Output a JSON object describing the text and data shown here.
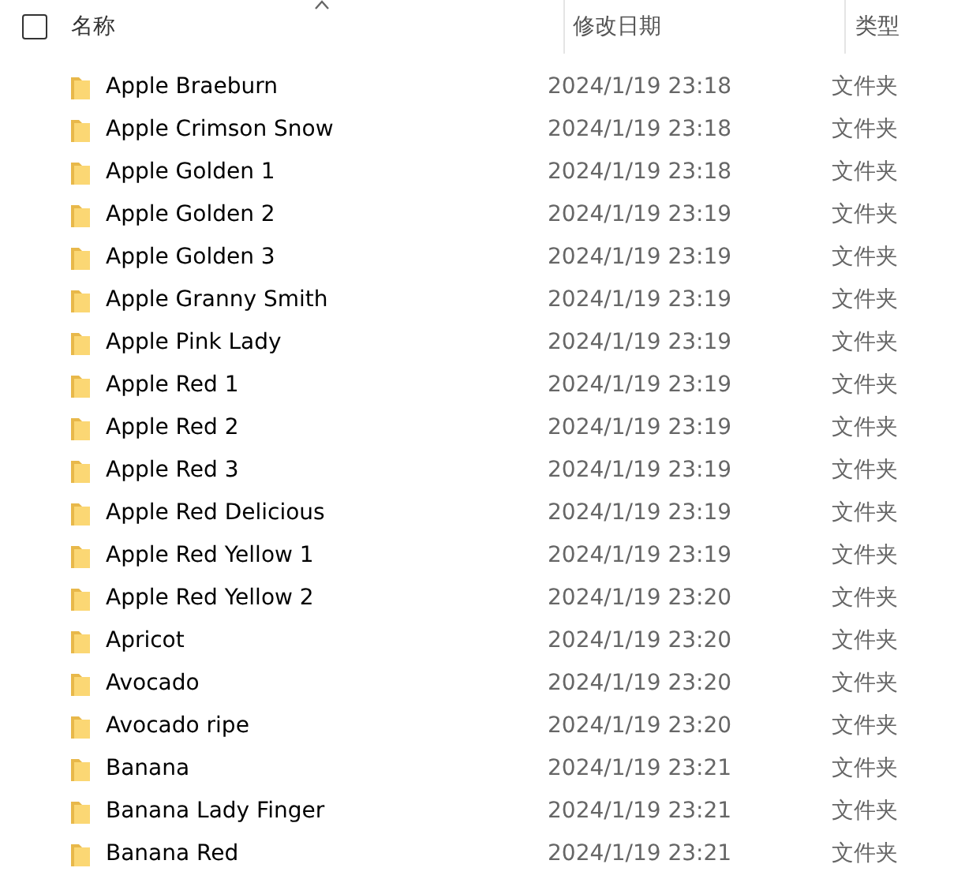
{
  "header": {
    "select_all_checked": false,
    "columns": [
      {
        "label": "名称",
        "sorted": true
      },
      {
        "label": "修改日期",
        "sorted": false
      },
      {
        "label": "类型",
        "sorted": false
      }
    ]
  },
  "rows": [
    {
      "name": "Apple Braeburn",
      "modified": "2024/1/19 23:18",
      "type": "文件夹"
    },
    {
      "name": "Apple Crimson Snow",
      "modified": "2024/1/19 23:18",
      "type": "文件夹"
    },
    {
      "name": "Apple Golden 1",
      "modified": "2024/1/19 23:18",
      "type": "文件夹"
    },
    {
      "name": "Apple Golden 2",
      "modified": "2024/1/19 23:19",
      "type": "文件夹"
    },
    {
      "name": "Apple Golden 3",
      "modified": "2024/1/19 23:19",
      "type": "文件夹"
    },
    {
      "name": "Apple Granny Smith",
      "modified": "2024/1/19 23:19",
      "type": "文件夹"
    },
    {
      "name": "Apple Pink Lady",
      "modified": "2024/1/19 23:19",
      "type": "文件夹"
    },
    {
      "name": "Apple Red 1",
      "modified": "2024/1/19 23:19",
      "type": "文件夹"
    },
    {
      "name": "Apple Red 2",
      "modified": "2024/1/19 23:19",
      "type": "文件夹"
    },
    {
      "name": "Apple Red 3",
      "modified": "2024/1/19 23:19",
      "type": "文件夹"
    },
    {
      "name": "Apple Red Delicious",
      "modified": "2024/1/19 23:19",
      "type": "文件夹"
    },
    {
      "name": "Apple Red Yellow 1",
      "modified": "2024/1/19 23:19",
      "type": "文件夹"
    },
    {
      "name": "Apple Red Yellow 2",
      "modified": "2024/1/19 23:20",
      "type": "文件夹"
    },
    {
      "name": "Apricot",
      "modified": "2024/1/19 23:20",
      "type": "文件夹"
    },
    {
      "name": "Avocado",
      "modified": "2024/1/19 23:20",
      "type": "文件夹"
    },
    {
      "name": "Avocado ripe",
      "modified": "2024/1/19 23:20",
      "type": "文件夹"
    },
    {
      "name": "Banana",
      "modified": "2024/1/19 23:21",
      "type": "文件夹"
    },
    {
      "name": "Banana Lady Finger",
      "modified": "2024/1/19 23:21",
      "type": "文件夹"
    },
    {
      "name": "Banana Red",
      "modified": "2024/1/19 23:21",
      "type": "文件夹"
    }
  ]
}
